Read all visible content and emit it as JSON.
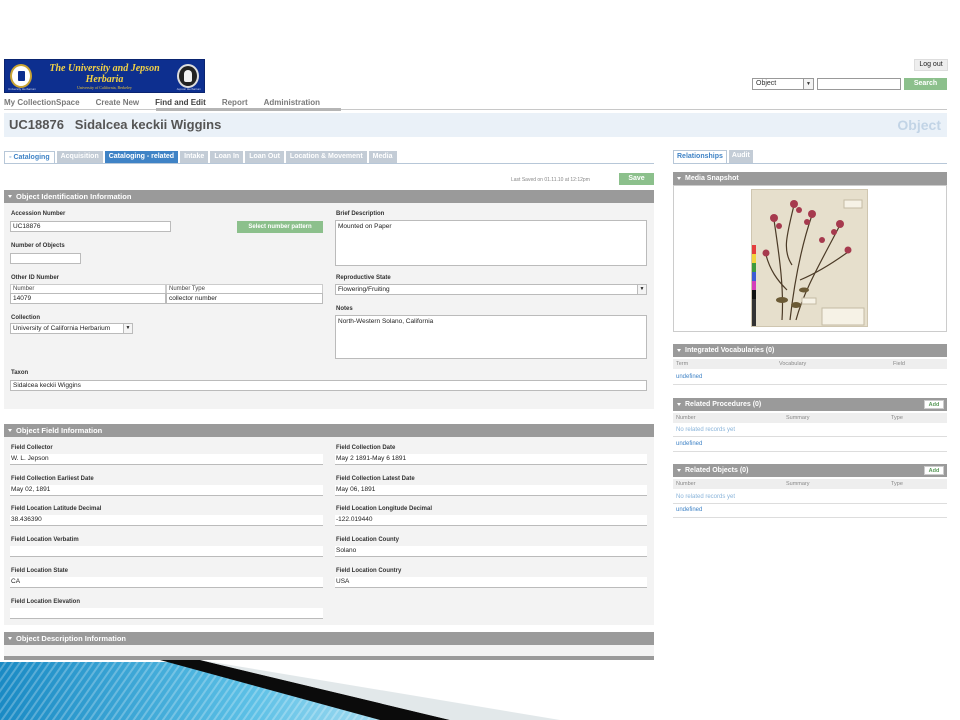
{
  "logo": {
    "line1": "The University and Jepson",
    "line2": "Herbaria",
    "line3": "University of California, Berkeley",
    "corner_left": "University Herbarium",
    "corner_right": "Jepson Herbarium"
  },
  "header": {
    "logout": "Log out",
    "search_type": "Object",
    "search_value": "",
    "search_button": "Search"
  },
  "nav": [
    "My CollectionSpace",
    "Create New",
    "Find and Edit",
    "Report",
    "Administration"
  ],
  "nav_active": "Find and Edit",
  "record": {
    "id": "UC18876",
    "name": "Sidalcea keckii Wiggins",
    "type": "Object"
  },
  "tabs": [
    "Cataloging",
    "Acquisition",
    "Cataloging - related",
    "Intake",
    "Loan In",
    "Loan Out",
    "Location & Movement",
    "Media"
  ],
  "active_tab": "Cataloging",
  "last_saved": "Last Saved on 01.11.10 at 12:12pm",
  "save_button": "Save",
  "identification": {
    "title": "Object Identification Information",
    "accession_label": "Accession Number",
    "accession_value": "UC18876",
    "pattern_button": "Select number pattern",
    "num_objects_label": "Number of Objects",
    "num_objects_value": "",
    "other_id_label": "Other ID Number",
    "other_id_col_number": "Number",
    "other_id_col_type": "Number Type",
    "other_id_number": "14079",
    "other_id_type": "collector number",
    "collection_label": "Collection",
    "collection_value": "University of California Herbarium",
    "brief_desc_label": "Brief Description",
    "brief_desc_value": "Mounted on Paper",
    "repro_label": "Reproductive State",
    "repro_value": "Flowering/Fruiting",
    "notes_label": "Notes",
    "notes_value": "North-Western Solano, California",
    "taxon_label": "Taxon",
    "taxon_value": "Sidalcea keckii Wiggins"
  },
  "field_info": {
    "title": "Object Field Information",
    "collector_label": "Field Collector",
    "collector_value": "W. L. Jepson",
    "coll_date_label": "Field Collection Date",
    "coll_date_value": "May 2 1891-May 6 1891",
    "earliest_label": "Field Collection Earliest Date",
    "earliest_value": "May 02, 1891",
    "latest_label": "Field Collection Latest Date",
    "latest_value": "May 06, 1891",
    "lat_label": "Field Location Latitude Decimal",
    "lat_value": "38.436390",
    "lon_label": "Field Location Longitude Decimal",
    "lon_value": "-122.019440",
    "verbatim_label": "Field Location Verbatim",
    "verbatim_value": "",
    "county_label": "Field Location County",
    "county_value": "Solano",
    "state_label": "Field Location State",
    "state_value": "CA",
    "country_label": "Field Location Country",
    "country_value": "USA",
    "elevation_label": "Field Location Elevation",
    "elevation_value": ""
  },
  "description": {
    "title": "Object Description Information"
  },
  "right": {
    "tabs": [
      "Relationships",
      "Audit"
    ],
    "media_title": "Media Snapshot",
    "vocab_title": "Integrated Vocabularies (0)",
    "vocab_cols": [
      "Term",
      "Vocabulary",
      "Field"
    ],
    "vocab_link": "undefined",
    "proc_title": "Related Procedures (0)",
    "proc_cols": [
      "Number",
      "Summary",
      "Type"
    ],
    "proc_empty": "No related records yet",
    "proc_link": "undefined",
    "obj_title": "Related Objects (0)",
    "obj_cols": [
      "Number",
      "Summary",
      "Type"
    ],
    "obj_empty": "No related records yet",
    "obj_link": "undefined",
    "add_label": "Add"
  }
}
